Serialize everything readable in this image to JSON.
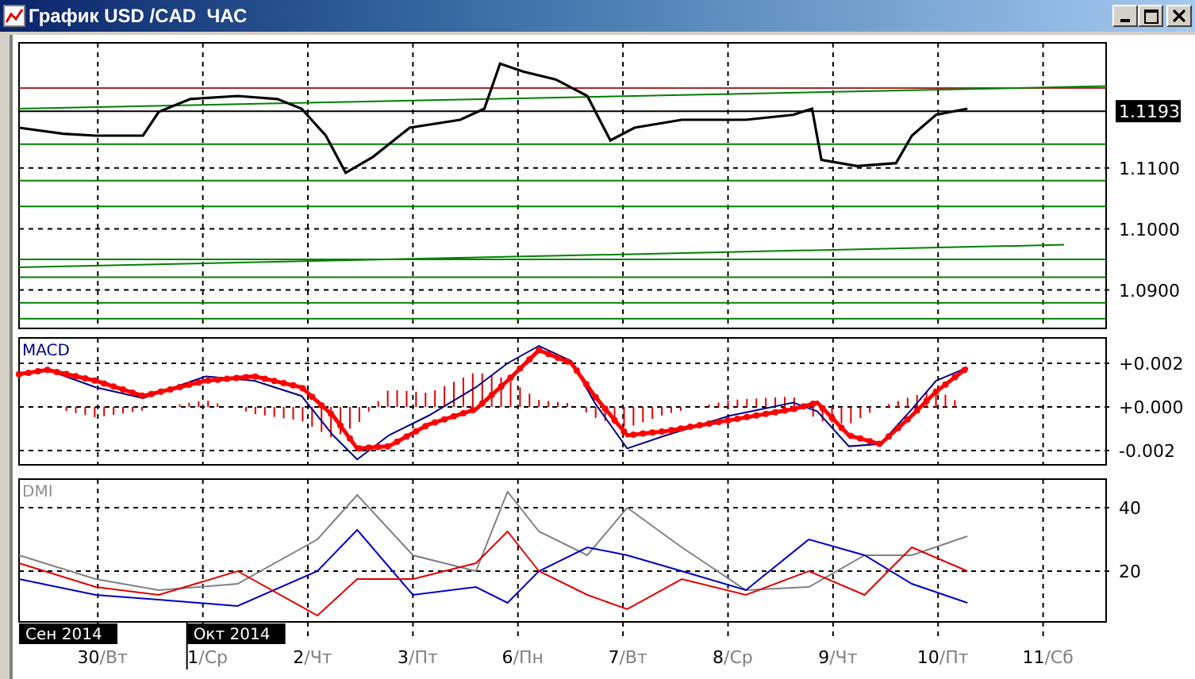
{
  "window": {
    "title": "График USD /CAD  ЧАС"
  },
  "price_panel": {
    "last_price": "1.1193",
    "y_labels": [
      "1.1100",
      "1.1000",
      "1.0900"
    ]
  },
  "macd_panel": {
    "title": "MACD",
    "y_labels": [
      "+0.002",
      "+0.000",
      "-0.002"
    ]
  },
  "dmi_panel": {
    "title": "DMI",
    "y_labels": [
      "40",
      "20"
    ]
  },
  "period_labels": [
    "Сен 2014",
    "Окт 2014"
  ],
  "x_labels": [
    "30/Вт",
    "1/Ср",
    "2/Чт",
    "3/Пт",
    "6/Пн",
    "7/Вт",
    "8/Ср",
    "9/Чт",
    "10/Пт",
    "11/Сб"
  ]
}
